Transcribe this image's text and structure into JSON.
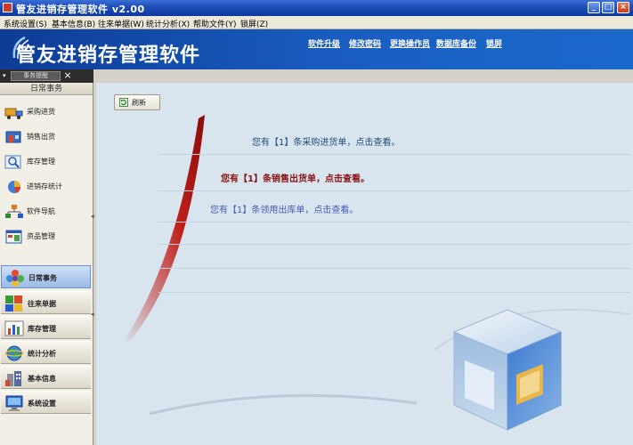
{
  "window": {
    "title": "管友进销存管理软件 v2.00",
    "controls": {
      "minimize": "_",
      "maximize": "□",
      "close": "×"
    }
  },
  "menu": [
    "系统设置(S)",
    "基本信息(B)",
    "往来单据(W)",
    "统计分析(X)",
    "帮助文件(Y)",
    "锁屏(Z)"
  ],
  "banner": {
    "logo_text": "管友进销存管理软件",
    "links": [
      "软件升级",
      "修改密码",
      "更换操作员",
      "数据库备份",
      "锁屏"
    ]
  },
  "toolstrip": {
    "tab_label": "事务提醒",
    "close": "×",
    "pin": "▾"
  },
  "sidebar": {
    "section_title": "日常事务",
    "items": [
      {
        "label": "采购进货",
        "icon": "truck-icon"
      },
      {
        "label": "销售出货",
        "icon": "shop-icon"
      },
      {
        "label": "库存管理",
        "icon": "magnifier-icon"
      },
      {
        "label": "进销存统计",
        "icon": "pie-chart-icon"
      },
      {
        "label": "软件导航",
        "icon": "org-chart-icon"
      },
      {
        "label": "资品管理",
        "icon": "window-icon"
      }
    ],
    "nav": [
      {
        "label": "日常事务",
        "icon": "flower-icon",
        "active": true
      },
      {
        "label": "往来单据",
        "icon": "puzzle-icon",
        "active": false
      },
      {
        "label": "库存管理",
        "icon": "bar-chart-icon",
        "active": false
      },
      {
        "label": "统计分析",
        "icon": "globe-icon",
        "active": false
      },
      {
        "label": "基本信息",
        "icon": "building-icon",
        "active": false
      },
      {
        "label": "系统设置",
        "icon": "monitor-icon",
        "active": false
      }
    ]
  },
  "main": {
    "refresh_label": "刷新",
    "messages": [
      "您有【1】条采购进货单，点击查看。",
      "您有【1】条销售出货单，点击查看。",
      "您有【1】条领用出库单，点击查看。"
    ]
  },
  "colors": {
    "titlebar": "#1f4fb8",
    "banner": "#1a5ec2",
    "main_bg": "#d8e4ee",
    "accent_red": "#c0201a"
  }
}
